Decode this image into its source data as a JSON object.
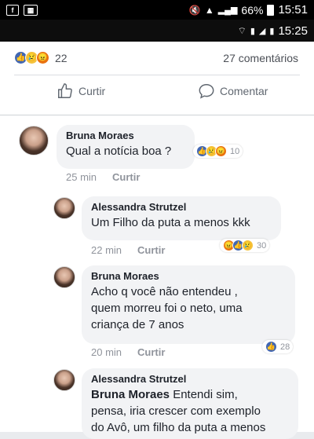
{
  "status_bar_1": {
    "battery": "66%",
    "time": "15:51",
    "left_icons": [
      "facebook-icon",
      "gallery-icon"
    ]
  },
  "status_bar_2": {
    "time": "15:25"
  },
  "post": {
    "reaction_count": "22",
    "comments_count": "27 comentários",
    "like_label": "Curtir",
    "comment_label": "Comentar"
  },
  "comments": [
    {
      "author": "Bruna Moraes",
      "text": "Qual a notícia boa ?",
      "time": "25 min",
      "reply": "Curtir",
      "reactions": "10"
    },
    {
      "author": "Alessandra Strutzel",
      "text": "Um Filho da puta a menos kkk",
      "time": "22 min",
      "reply": "Curtir",
      "reactions": "30"
    },
    {
      "author": "Bruna Moraes",
      "text_lines": [
        "Acho q você não entendeu ,",
        "quem morreu foi o neto, uma",
        "criança de 7 anos"
      ],
      "time": "20 min",
      "reply": "Curtir",
      "reactions": "28"
    },
    {
      "author": "Alessandra Strutzel",
      "mention": "Bruna Moraes",
      "text_first": " Entendi sim,",
      "text_lines": [
        "pensa, iria crescer com exemplo",
        "do Avô, um filho da puta a menos"
      ]
    }
  ]
}
